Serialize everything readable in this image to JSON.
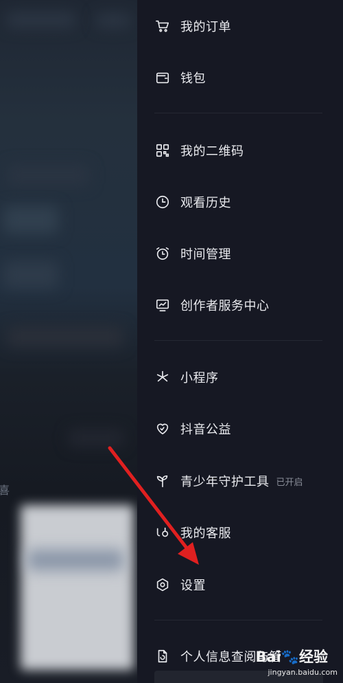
{
  "menu": {
    "items": [
      {
        "label": "我的订单",
        "icon": "cart-icon"
      },
      {
        "label": "钱包",
        "icon": "wallet-icon"
      },
      {
        "label": "我的二维码",
        "icon": "qr-code-icon"
      },
      {
        "label": "观看历史",
        "icon": "clock-icon"
      },
      {
        "label": "时间管理",
        "icon": "alarm-icon"
      },
      {
        "label": "创作者服务中心",
        "icon": "chart-monitor-icon"
      },
      {
        "label": "小程序",
        "icon": "asterisk-icon"
      },
      {
        "label": "抖音公益",
        "icon": "heart-icon"
      },
      {
        "label": "青少年守护工具",
        "icon": "sprout-icon",
        "badge": "已开启"
      },
      {
        "label": "我的客服",
        "icon": "support-icon"
      },
      {
        "label": "设置",
        "icon": "gear-icon"
      },
      {
        "label": "个人信息查阅与管",
        "icon": "document-icon"
      }
    ]
  },
  "background": {
    "visible_char": "喜"
  },
  "watermark": {
    "logo_text": "Bai",
    "logo_suffix": "经验",
    "url": "jingyan.baidu.com"
  },
  "colors": {
    "drawer_bg": "#161823",
    "text": "#e9eaee",
    "badge_text": "#8a8e99",
    "arrow": "#e02020"
  }
}
